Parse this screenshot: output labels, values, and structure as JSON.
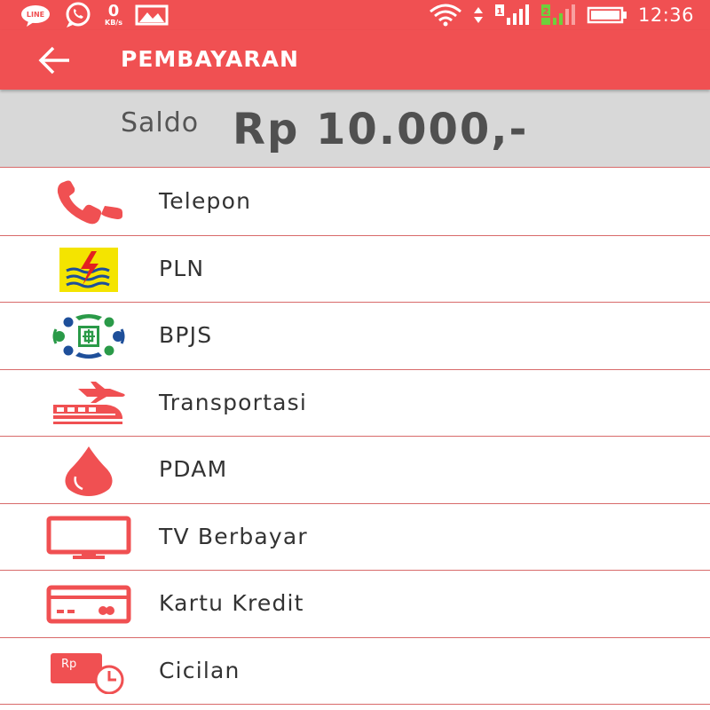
{
  "status_bar": {
    "line_label": "LINE",
    "speed_value": "0",
    "speed_unit": "KB/s",
    "sim1_label": "1",
    "sim2_label": "2",
    "time": "12:36"
  },
  "header": {
    "title": "PEMBAYARAN"
  },
  "balance": {
    "label": "Saldo",
    "amount": "Rp 10.000,-"
  },
  "menu": {
    "items": [
      {
        "label": "Telepon",
        "icon": "phone-icon"
      },
      {
        "label": "PLN",
        "icon": "pln-logo-icon"
      },
      {
        "label": "BPJS",
        "icon": "bpjs-logo-icon"
      },
      {
        "label": "Transportasi",
        "icon": "train-plane-icon"
      },
      {
        "label": "PDAM",
        "icon": "water-drop-icon"
      },
      {
        "label": "TV Berbayar",
        "icon": "tv-icon"
      },
      {
        "label": "Kartu Kredit",
        "icon": "credit-card-icon"
      },
      {
        "label": "Cicilan",
        "icon": "installment-icon"
      }
    ],
    "cicilan_icon_text": "Rp"
  },
  "colors": {
    "primary": "#f05052",
    "balance_bg": "#d8d8d8",
    "divider": "#d86a6a",
    "pln_yellow": "#f4e400",
    "bpjs_green": "#2a9a48",
    "bpjs_blue": "#1e4f9a"
  }
}
